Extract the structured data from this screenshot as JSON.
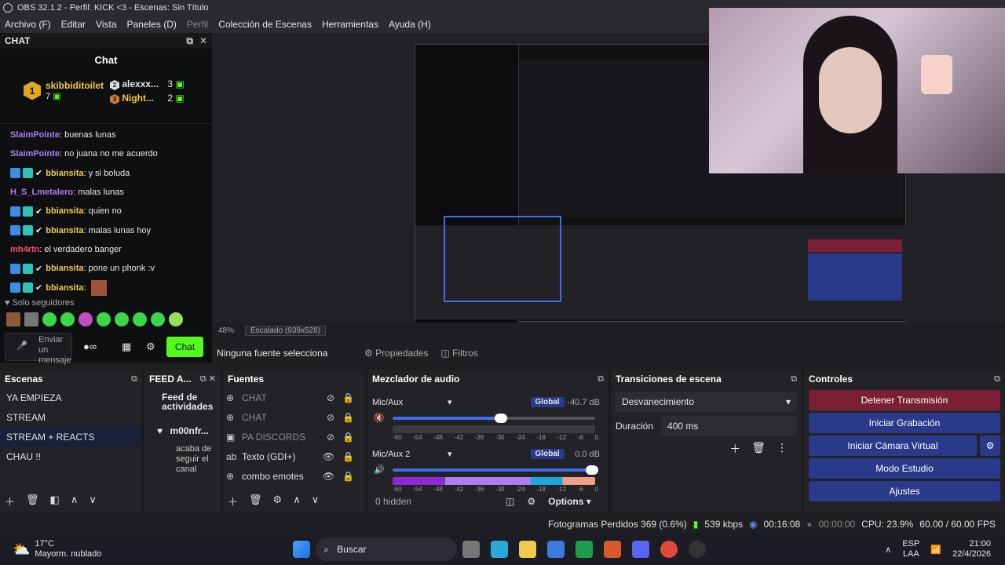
{
  "window": {
    "title": "OBS 32.1.2 - Perfil: KICK <3 - Escenas: Sin Título"
  },
  "menu": [
    "Archivo (F)",
    "Editar",
    "Vista",
    "Paneles (D)",
    "Perfil",
    "Colección de Escenas",
    "Herramientas",
    "Ayuda (H)"
  ],
  "chat": {
    "dock_title": "CHAT",
    "panel_title": "Chat",
    "leaderboard": {
      "first": {
        "rank": "1",
        "name": "skibbiditoilet",
        "count": "7"
      },
      "second": {
        "rank": "2",
        "name": "alexxx...",
        "count": "3"
      },
      "third": {
        "rank": "3",
        "name": "Night...",
        "count": "2"
      }
    },
    "messages": [
      {
        "user": "SlaimPointe",
        "text": ": buenas lunas",
        "cls": "u1",
        "badges": false
      },
      {
        "user": "SlaimPointe",
        "text": ": no juana no me acuerdo",
        "cls": "u1",
        "badges": false
      },
      {
        "user": "bbiansita",
        "text": ": y si boluda",
        "cls": "u2",
        "badges": true
      },
      {
        "user": "H_S_Lmetalero",
        "text": ": malas lunas",
        "cls": "u1",
        "badges": false
      },
      {
        "user": "bbiansita",
        "text": ": quien no",
        "cls": "u2",
        "badges": true
      },
      {
        "user": "bbiansita",
        "text": ": malas lunas hoy",
        "cls": "u2",
        "badges": true
      },
      {
        "user": "mh4rtn",
        "text": ": el verdadero banger",
        "cls": "u3",
        "badges": false
      },
      {
        "user": "bbiansita",
        "text": ": pone un phonk :v",
        "cls": "u2",
        "badges": true
      },
      {
        "user": "bbiansita",
        "text": ":",
        "cls": "u2",
        "badges": true
      }
    ],
    "followers_only": "Solo seguidores",
    "input_placeholder": "Enviar un mensaje",
    "send_label": "Chat"
  },
  "preview": {
    "zoom": "48%",
    "scale": "Escalado (939x528)"
  },
  "source_bar": {
    "status": "Ninguna fuente selecciona",
    "properties": "Propiedades",
    "filters": "Filtros"
  },
  "scenes": {
    "title": "Escenas",
    "items": [
      "YA EMPIEZA",
      "STREAM",
      "STREAM + REACTS",
      "CHAU !!"
    ],
    "selected": 2
  },
  "feed": {
    "title": "FEED A...",
    "heading": "Feed de actividades",
    "user": "m00nfr...",
    "action": "acaba de seguir el canal"
  },
  "sources": {
    "title": "Fuentes",
    "items": [
      {
        "name": "CHAT",
        "visible": false
      },
      {
        "name": "CHAT",
        "visible": false
      },
      {
        "name": "PA DISCORDS",
        "visible": false
      },
      {
        "name": "Texto (GDI+)",
        "visible": true
      },
      {
        "name": "combo emotes",
        "visible": true
      }
    ]
  },
  "mixer": {
    "title": "Mezclador de audio",
    "ticks": [
      "-60",
      "-54",
      "-48",
      "-42",
      "-36",
      "-30",
      "-24",
      "-18",
      "-12",
      "-6",
      "0"
    ],
    "channels": [
      {
        "name": "Mic/Aux",
        "db": "-40.7 dB",
        "global": "Global",
        "volume": 0.55,
        "muted": true
      },
      {
        "name": "Mic/Aux 2",
        "db": "0.0 dB",
        "global": "Global",
        "volume": 1.0,
        "muted": false
      }
    ],
    "hidden": "0 hidden",
    "options": "Options"
  },
  "transitions": {
    "title": "Transiciones de escena",
    "selected": "Desvanecimiento",
    "duration_label": "Duración",
    "duration": "400 ms"
  },
  "controls": {
    "title": "Controles",
    "buttons": [
      "Detener Transmisión",
      "Iniciar Grabación",
      "Iniciar Cámara Virtual",
      "Modo Estudio",
      "Ajustes"
    ]
  },
  "status": {
    "dropped": "Fotogramas Perdidos 369 (0.6%)",
    "kbps": "539 kbps",
    "stream_time": "00:16:08",
    "rec_time": "00:00:00",
    "cpu": "CPU: 23.9%",
    "fps": "60.00 / 60.00 FPS"
  },
  "taskbar": {
    "temp": "17°C",
    "weather": "Mayorm. nublado",
    "search": "Buscar",
    "lang1": "ESP",
    "lang2": "LAA",
    "time": "21:00",
    "date": "22/4/2026"
  },
  "colors": {
    "kick_green": "#53fc18",
    "stop_red": "#7a1f35",
    "button_blue": "#2a3a8a"
  }
}
